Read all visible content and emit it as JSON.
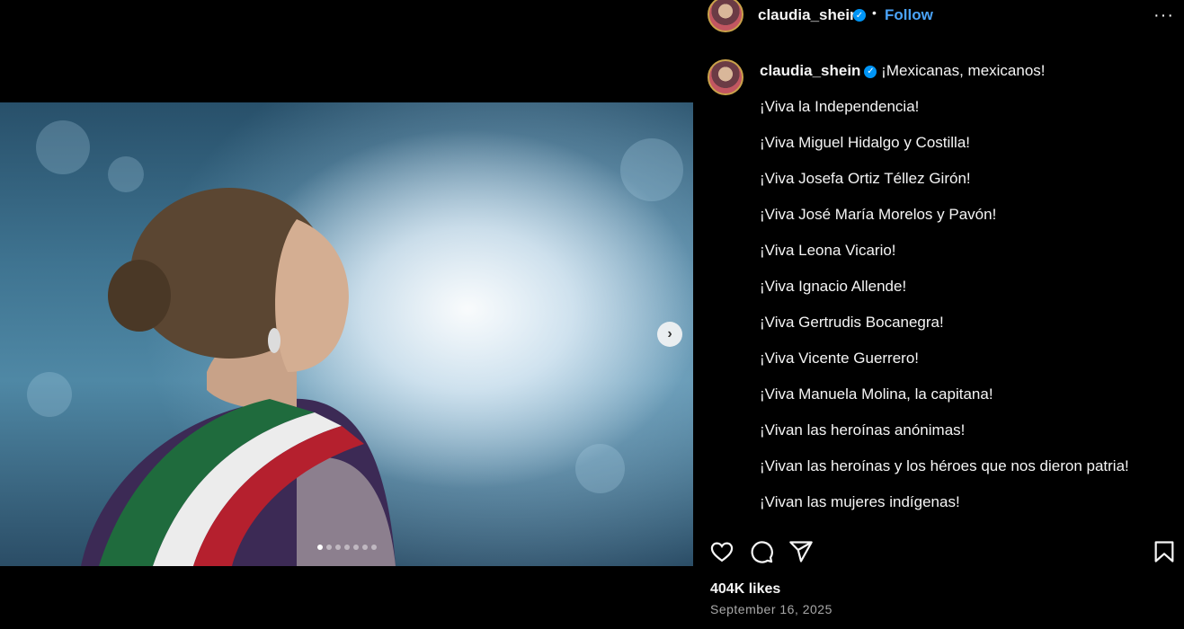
{
  "post": {
    "username": "claudia_shein",
    "verified_mark": "✓",
    "separator": "•",
    "follow_label": "Follow",
    "more_label": "···",
    "next_label": "›"
  },
  "caption": {
    "first_line": "¡Mexicanas, mexicanos!",
    "lines": [
      "¡Viva la Independencia!",
      "¡Viva Miguel Hidalgo y Costilla!",
      "¡Viva Josefa Ortiz Téllez Girón!",
      "¡Viva José María Morelos y Pavón!",
      "¡Viva Leona Vicario!",
      "¡Viva Ignacio Allende!",
      "¡Viva Gertrudis Bocanegra!",
      "¡Viva Vicente Guerrero!",
      "¡Viva Manuela Molina, la capitana!",
      "¡Vivan las heroínas anónimas!",
      "¡Vivan las heroínas y los héroes que nos dieron patria!",
      "¡Vivan las mujeres indígenas!"
    ]
  },
  "stats": {
    "likes": "404K likes",
    "date": "September 16, 2025"
  },
  "carousel": {
    "count": 7,
    "active": 0
  },
  "icons": {
    "like": "heart-icon",
    "comment": "comment-icon",
    "share": "send-icon",
    "save": "bookmark-icon"
  },
  "colors": {
    "follow": "#4aa3f7",
    "verified": "#0095f6",
    "background": "#000000"
  }
}
